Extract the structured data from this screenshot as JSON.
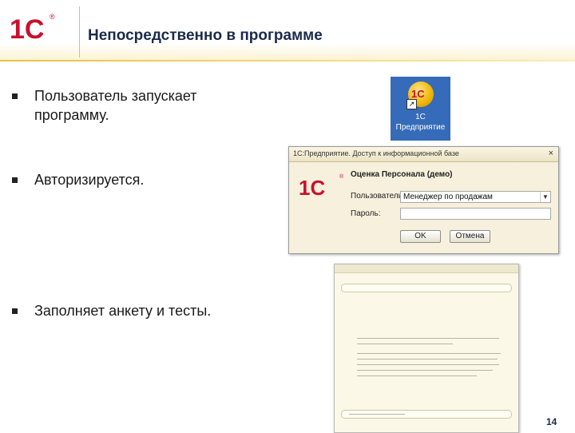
{
  "header": {
    "logo": "1С",
    "logo_reg": "®",
    "title": "Непосредственно в программе"
  },
  "bullets": [
    {
      "text": "Пользователь запускает программу."
    },
    {
      "text": "Авторизируется."
    },
    {
      "text": "Заполняет анкету и тесты."
    }
  ],
  "shortcut": {
    "icon_text": "1С",
    "arrow": "↗",
    "label_line1": "1С",
    "label_line2": "Предприятие",
    "background": "#356bb8"
  },
  "login_dialog": {
    "window_title": "1С:Предприятие. Доступ к информационной базе",
    "close_icon": "×",
    "logo": "1С",
    "logo_reg": "®",
    "base_name": "Оценка Персонала (демо)",
    "user_label": "Пользователь:",
    "user_value": "Менеджер по продажам",
    "password_label": "Пароль:",
    "password_value": "",
    "ok_label": "OK",
    "cancel_label": "Отмена"
  },
  "page_number": "14",
  "colors": {
    "accent_gold": "#e4c04a",
    "brand_red": "#c8102e",
    "title_navy": "#1a2a4a"
  }
}
